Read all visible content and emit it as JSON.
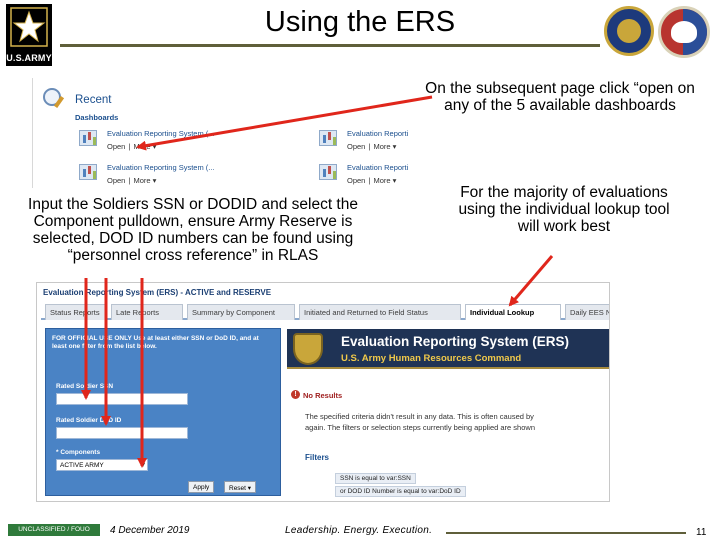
{
  "header": {
    "title": "Using the ERS",
    "logo_text": "U.S.ARMY"
  },
  "callouts": {
    "open_dashboard": "On the subsequent page click “open on any of the 5 available dashboards",
    "input_ssn": "Input the Soldiers SSN or DODID and select the Component pulldown, ensure Army Reserve is selected, DOD ID numbers can be found using “personnel cross reference” in RLAS",
    "lookup_tool": "For the majority of evaluations using the individual lookup tool will work best"
  },
  "recent": {
    "title": "Recent",
    "section": "Dashboards",
    "items": [
      {
        "name": "Evaluation Reporting System (...",
        "open": "Open",
        "sep": "|",
        "more": "More ▾"
      },
      {
        "name": "Evaluation Reporti",
        "open": "Open",
        "sep": "|",
        "more": "More ▾"
      },
      {
        "name": "Evaluation Reporting System (...",
        "open": "Open",
        "sep": "|",
        "more": "More ▾"
      },
      {
        "name": "Evaluation Reporti",
        "open": "Open",
        "sep": "|",
        "more": "More ▾"
      }
    ]
  },
  "app": {
    "title": "Evaluation Reporting System (ERS) - ACTIVE and RESERVE",
    "tabs": [
      "Status Reports",
      "Late Reports",
      "Summary by Component",
      "Initiated and Returned to Field Status",
      "Individual Lookup",
      "Daily EES N"
    ],
    "active_tab": "Individual Lookup",
    "filter": {
      "notice": "FOR OFFICIAL USE ONLY Use at least either SSN or DoD ID, and at least one filter from the list below.",
      "ssn_label": "Rated Soldier SSN",
      "ssn_value": "",
      "dodid_label": "Rated Soldier DoD ID",
      "dodid_value": "",
      "component_label": "* Components",
      "component_value": "ACTIVE ARMY",
      "apply": "Apply",
      "reset": "Reset ▾"
    },
    "banner": {
      "line1": "Evaluation Reporting System (ERS)",
      "line2": "U.S. Army Human Resources Command"
    },
    "results": {
      "heading": "No Results",
      "text1": "The specified criteria didn't result in any data. This is often caused by",
      "text2": "again. The filters or selection steps currently being applied are shown",
      "filters_heading": "Filters",
      "filter1": "SSN is equal to var:SSN",
      "filter2": "or DOD ID Number is equal to var:DoD ID"
    }
  },
  "footer": {
    "classification": "UNCLASSIFIED / FOUO",
    "date": "4 December 2019",
    "motto": "Leadership. Energy. Execution.",
    "page": "11"
  },
  "colors": {
    "arrow": "#e0261b",
    "rule": "#5f5f3a",
    "filter_panel": "#4a83c5"
  }
}
